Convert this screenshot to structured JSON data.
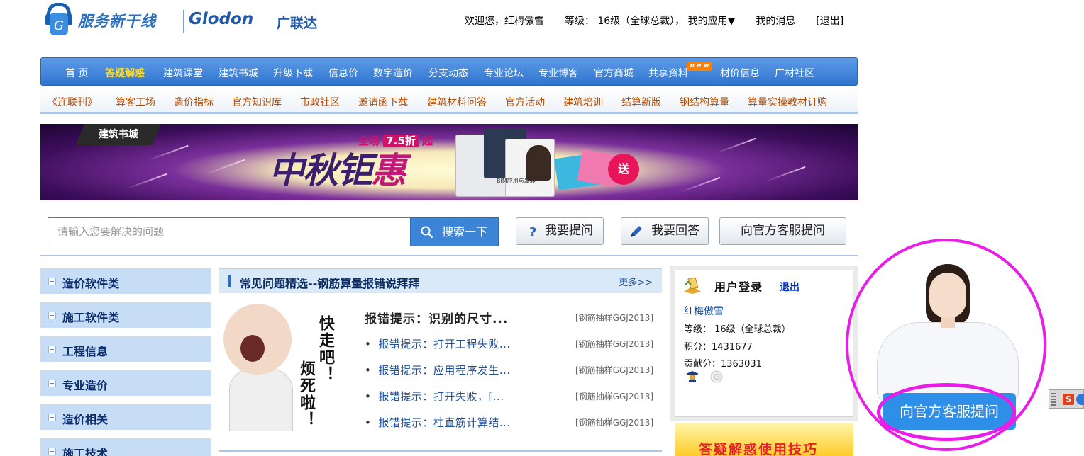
{
  "header": {
    "logo_service": "服务新干线",
    "logo_glodon": "Glodon",
    "logo_cn": "广联达",
    "welcome": "欢迎您，",
    "username": "红梅傲雪",
    "level_label": "等级：",
    "level_value": "16级（全球总裁），",
    "my_apps": "我的应用▼",
    "my_messages": "我的消息",
    "logout": "[退出]"
  },
  "main_nav": {
    "items": [
      "首 页",
      "答疑解惑",
      "建筑课堂",
      "建筑书城",
      "升级下载",
      "信息价",
      "数字造价",
      "分支动态",
      "专业论坛",
      "专业博客",
      "官方商城",
      "共享资料",
      "材价信息",
      "广材社区"
    ],
    "active": "答疑解惑",
    "new_tag": "n e w"
  },
  "sub_nav": {
    "items": [
      "《连联刊》",
      "算客工场",
      "造价指标",
      "官方知识库",
      "市政社区",
      "邀请函下载",
      "建筑材料问答",
      "官方活动",
      "建筑培训",
      "结算新版",
      "钢结构算量",
      "算量实操教材订购"
    ]
  },
  "banner": {
    "tab": "建筑书城",
    "promo_prefix": "全场",
    "promo_pct": "7.5折",
    "promo_suffix": "起",
    "headline_1": "中秋钜",
    "headline_2": "惠",
    "book_label": "BIM应用与发展",
    "gift": "送"
  },
  "search": {
    "placeholder": "请输入您要解决的问题",
    "button": "搜索一下",
    "ask_button": "我要提问",
    "answer_button": "我要回答",
    "service_button": "向官方客服提问"
  },
  "categories": [
    "造价软件类",
    "施工软件类",
    "工程信息",
    "专业造价",
    "造价相关",
    "施工技术"
  ],
  "faq": {
    "title": "常见问题精选--钢筋算量报错说拜拜",
    "more": "更多>>",
    "image_text_1": "快走吧！",
    "image_text_2": "烦死啦！",
    "first": {
      "title": "报错提示：识别的尺寸...",
      "tag": "[钢筋抽样GGJ2013]"
    },
    "items": [
      {
        "title": "报错提示：打开工程失败...",
        "tag": "[钢筋抽样GGJ2013]"
      },
      {
        "title": "报错提示：应用程序发生...",
        "tag": "[钢筋抽样GGJ2013]"
      },
      {
        "title": "报错提示：打开失败，[...",
        "tag": "[钢筋抽样GGJ2013]"
      },
      {
        "title": "报错提示：柱直筋计算结...",
        "tag": "[钢筋抽样GGJ2013]"
      }
    ]
  },
  "login": {
    "title": "用户登录",
    "logout": "退出",
    "username": "红梅傲雪",
    "level": "等级： 16级（全球总裁）",
    "points": "积分：1431677",
    "contribution": "贡献分：1363031"
  },
  "tips": {
    "title": "答疑解惑使用技巧"
  },
  "service_widget": {
    "button": "向官方客服提问"
  },
  "ime": {
    "logo": "S"
  }
}
